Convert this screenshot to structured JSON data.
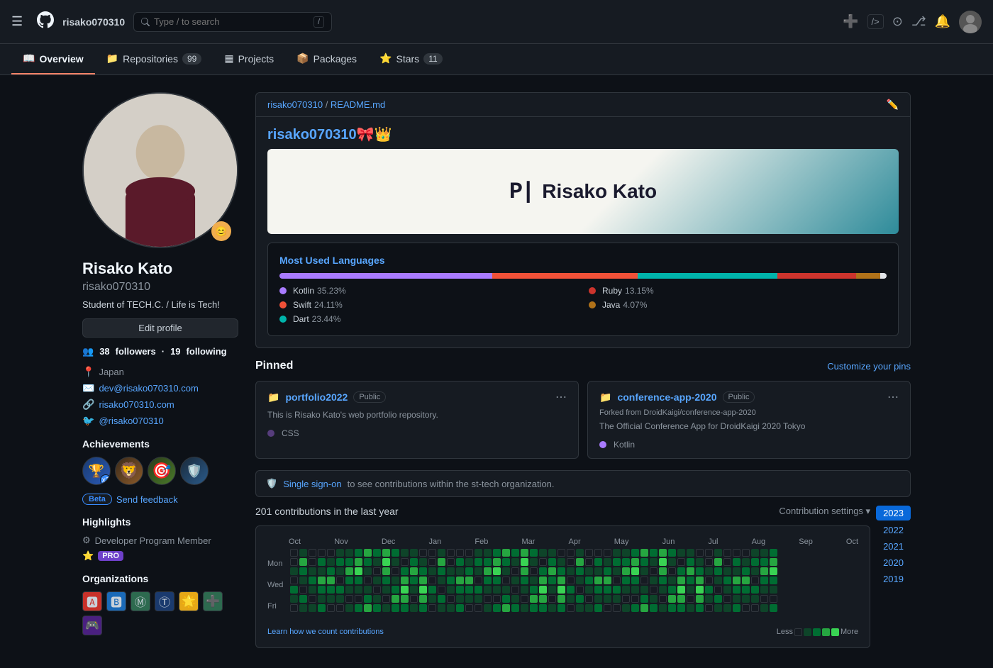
{
  "header": {
    "logo": "⬡",
    "username": "risako070310",
    "search_placeholder": "Type / to search",
    "slash_key": "/",
    "actions": {
      "plus": "+",
      "terminal": ">_",
      "issue": "⊙",
      "pr": "⎇",
      "notification": "🔔"
    }
  },
  "nav": {
    "tabs": [
      {
        "label": "Overview",
        "active": true,
        "icon": "📖",
        "badge": null
      },
      {
        "label": "Repositories",
        "active": false,
        "icon": "📁",
        "badge": "99"
      },
      {
        "label": "Projects",
        "active": false,
        "icon": "▦",
        "badge": null
      },
      {
        "label": "Packages",
        "active": false,
        "icon": "📦",
        "badge": null
      },
      {
        "label": "Stars",
        "active": false,
        "icon": "⭐",
        "badge": "11"
      }
    ]
  },
  "profile": {
    "name": "Risako Kato",
    "username": "risako070310",
    "bio": "Student of TECH.C. / Life is Tech!",
    "edit_button": "Edit profile",
    "followers": "38",
    "following": "19",
    "followers_label": "followers",
    "following_label": "following",
    "location": "Japan",
    "email": "dev@risako070310.com",
    "website": "risako070310.com",
    "twitter": "@risako070310"
  },
  "achievements": {
    "title": "Achievements",
    "items": [
      {
        "emoji": "🏆",
        "count": "x3"
      },
      {
        "emoji": "🐱",
        "count": null
      },
      {
        "emoji": "🎯",
        "count": null
      },
      {
        "emoji": "🛡️",
        "count": null
      }
    ],
    "beta_label": "Beta",
    "feedback_label": "Send feedback"
  },
  "highlights": {
    "title": "Highlights",
    "items": [
      {
        "label": "Developer Program Member",
        "icon": "⚙"
      },
      {
        "label": "PRO",
        "type": "badge"
      }
    ]
  },
  "organizations": {
    "title": "Organizations",
    "items": [
      "🟥",
      "🟦",
      "🟩",
      "🟨",
      "🟧",
      "🟪",
      "🔵"
    ]
  },
  "readme": {
    "path_user": "risako070310",
    "path_file": "README.md",
    "title": "risako070310🎀👑",
    "banner_text": "Risako Kato",
    "banner_logo": "P|"
  },
  "languages": {
    "title": "Most Used Languages",
    "items": [
      {
        "name": "Kotlin",
        "percent": "35.23%",
        "color": "#A97BFF",
        "bar": 35
      },
      {
        "name": "Ruby",
        "percent": "13.15%",
        "color": "#CC342D",
        "bar": 13
      },
      {
        "name": "Swift",
        "percent": "24.11%",
        "color": "#F05138",
        "bar": 24
      },
      {
        "name": "Java",
        "percent": "4.07%",
        "color": "#B07219",
        "bar": 4
      },
      {
        "name": "Dart",
        "percent": "23.44%",
        "color": "#00B4AB",
        "bar": 23
      }
    ]
  },
  "pinned": {
    "title": "Pinned",
    "customize_label": "Customize your pins",
    "repos": [
      {
        "name": "portfolio2022",
        "visibility": "Public",
        "description": "This is Risako Kato's web portfolio repository.",
        "language": "CSS",
        "lang_color": "#563d7c",
        "forked_from": null
      },
      {
        "name": "conference-app-2020",
        "visibility": "Public",
        "description": "The Official Conference App for DroidKaigi 2020 Tokyo",
        "language": "Kotlin",
        "lang_color": "#A97BFF",
        "forked_from": "Forked from DroidKaigi/conference-app-2020"
      }
    ]
  },
  "contributions": {
    "signon_text": "Single sign-on",
    "signon_desc": " to see contributions within the st-tech organization.",
    "title": "201 contributions in the last year",
    "settings_label": "Contribution settings",
    "years": [
      "2023",
      "2022",
      "2021",
      "2020",
      "2019"
    ],
    "active_year": "2023",
    "months": [
      "Oct",
      "Nov",
      "Dec",
      "Jan",
      "Feb",
      "Mar",
      "Apr",
      "May",
      "Jun",
      "Jul",
      "Aug",
      "Sep",
      "Oct"
    ],
    "day_labels": [
      "Mon",
      "",
      "Wed",
      "",
      "Fri"
    ],
    "legend_less": "Less",
    "legend_more": "More",
    "learn_link": "Learn how we count contributions"
  }
}
